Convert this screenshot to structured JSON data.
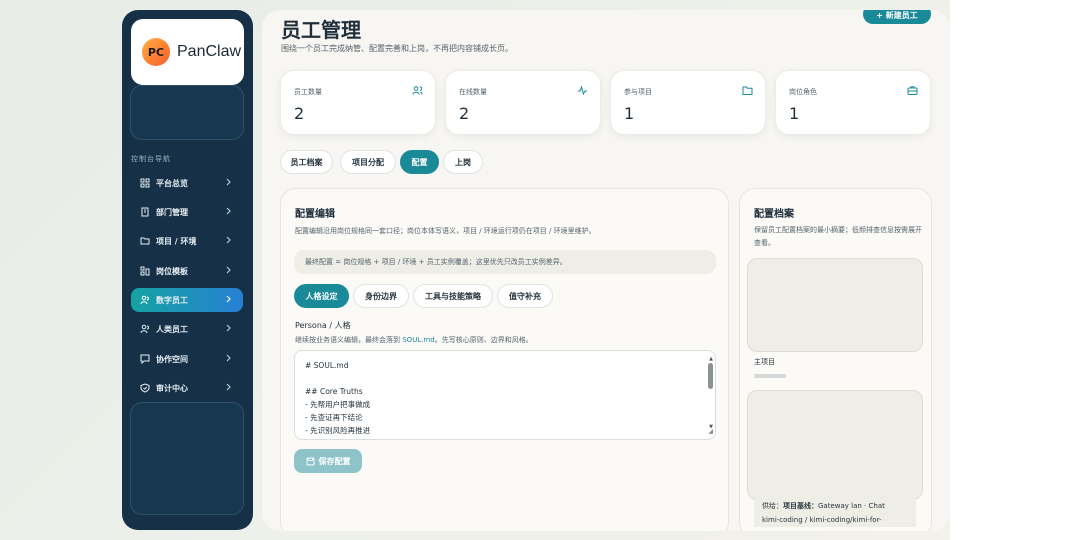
{
  "brand": {
    "logo_text": "PC",
    "name": "PanClaw"
  },
  "nav": {
    "heading": "控制台导航",
    "items": [
      {
        "label": "平台总览",
        "icon": "grid-icon"
      },
      {
        "label": "部门管理",
        "icon": "building-icon"
      },
      {
        "label": "项目 / 环境",
        "icon": "folder-icon"
      },
      {
        "label": "岗位模板",
        "icon": "template-icon"
      },
      {
        "label": "数字员工",
        "icon": "users-icon",
        "active": true
      },
      {
        "label": "人类员工",
        "icon": "user-icon"
      },
      {
        "label": "协作空间",
        "icon": "chat-icon"
      },
      {
        "label": "审计中心",
        "icon": "shield-icon"
      }
    ]
  },
  "page": {
    "title": "员工管理",
    "subtitle": "围绕一个员工完成纳管、配置完善和上岗，不再把内容铺成长页。",
    "new_button": "+ 新建员工"
  },
  "stats": [
    {
      "label": "员工数量",
      "value": "2",
      "icon": "people-icon"
    },
    {
      "label": "在线数量",
      "value": "2",
      "icon": "activity-icon"
    },
    {
      "label": "参与项目",
      "value": "1",
      "icon": "folder-icon"
    },
    {
      "label": "岗位角色",
      "value": "1",
      "icon": "briefcase-icon"
    }
  ],
  "tabs": [
    {
      "label": "员工档案"
    },
    {
      "label": "项目分配"
    },
    {
      "label": "配置",
      "active": true
    },
    {
      "label": "上岗"
    }
  ],
  "editor": {
    "title": "配置编辑",
    "description": "配置编辑沿用岗位规格同一套口径；岗位本体写语义，项目 / 环境运行项仍在项目 / 环境里维护。",
    "note": "最终配置 = 岗位规格 + 项目 / 环境 + 员工实例覆盖；这里优先只改员工实例差异。",
    "subtabs": [
      {
        "label": "人格设定",
        "active": true
      },
      {
        "label": "身份边界"
      },
      {
        "label": "工具与技能策略"
      },
      {
        "label": "值守补充"
      }
    ],
    "field_label": "Persona / 人格",
    "field_hint_prefix": "继续按业务语义编辑，最终会落到",
    "field_hint_file": "SOUL.md",
    "field_hint_suffix": "。先写核心原则、边界和风格。",
    "content_lines": [
      "# SOUL.md",
      "",
      "## Core Truths",
      "- 先帮用户把事做成",
      "- 先查证再下结论",
      "- 先识别风险再推进"
    ],
    "save_button": "保存配置"
  },
  "archive": {
    "title": "配置档案",
    "description": "保留员工配置档案的最小摘要；低频排查信息按需展开查看。",
    "main_project_label": "主项目",
    "footer_prefix": "供给：",
    "footer_bold": "项目基线：",
    "footer_text": "Gateway lan · Chat",
    "footer_line2": "kimi-coding / kimi-coding/kimi-for-"
  }
}
